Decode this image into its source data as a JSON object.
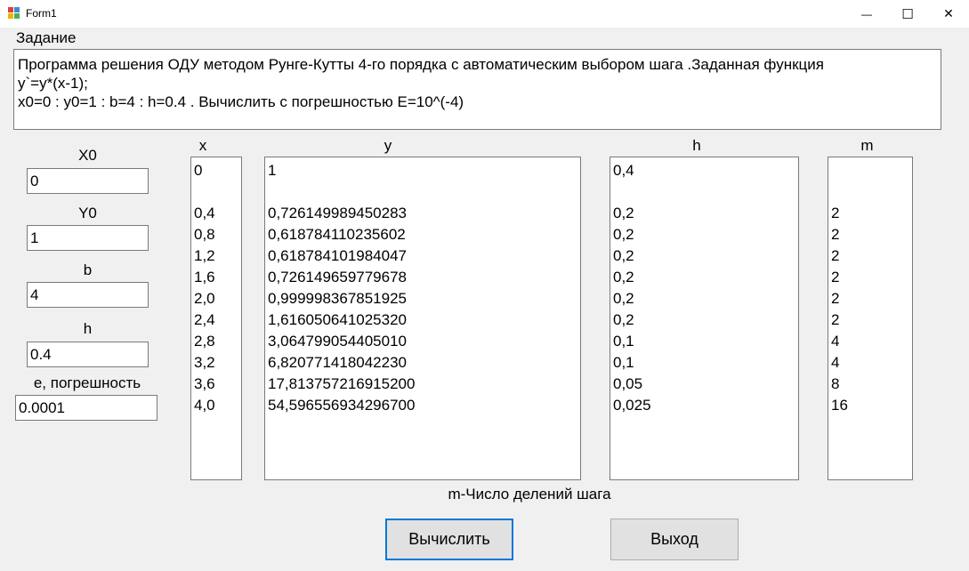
{
  "window": {
    "title": "Form1",
    "minimize_glyph": "—",
    "maximize_glyph": "☐",
    "close_glyph": "✕"
  },
  "task": {
    "heading": "Задание",
    "lines": [
      "Программа решения ОДУ методом Рунге-Кутты 4-го порядка с автоматическим выбором шага .Заданная функция",
      "y`=y*(x-1);",
      "x0=0 : y0=1 : b=4 : h=0.4  . Вычислить с погрешностью E=10^(-4)"
    ]
  },
  "inputs": {
    "x0": {
      "label": "X0",
      "value": "0"
    },
    "y0": {
      "label": "Y0",
      "value": "1"
    },
    "b": {
      "label": "b",
      "value": "4"
    },
    "h": {
      "label": "h",
      "value": "0.4"
    },
    "e": {
      "label": "е, погрешность",
      "value": "0.0001"
    }
  },
  "table": {
    "headers": {
      "x": "x",
      "y": "y",
      "h": "h",
      "m": "m"
    },
    "x": [
      "0",
      "",
      "0,4",
      "0,8",
      "1,2",
      "1,6",
      "2,0",
      "2,4",
      "2,8",
      "3,2",
      "3,6",
      "4,0"
    ],
    "y": [
      "1",
      "",
      "0,726149989450283",
      "0,618784110235602",
      "0,618784101984047",
      "0,726149659779678",
      "0,999998367851925",
      "1,616050641025320",
      "3,064799054405010",
      "6,820771418042230",
      "17,813757216915200",
      "54,596556934296700"
    ],
    "h": [
      "0,4",
      "",
      "0,2",
      "0,2",
      "0,2",
      "0,2",
      "0,2",
      "0,2",
      "0,1",
      "0,1",
      "0,05",
      "0,025"
    ],
    "m": [
      "",
      "",
      "2",
      "2",
      "2",
      "2",
      "2",
      "2",
      "4",
      "4",
      "8",
      "16"
    ]
  },
  "caption": "m-Число делений шага",
  "buttons": {
    "compute": "Вычислить",
    "exit": "Выход"
  }
}
